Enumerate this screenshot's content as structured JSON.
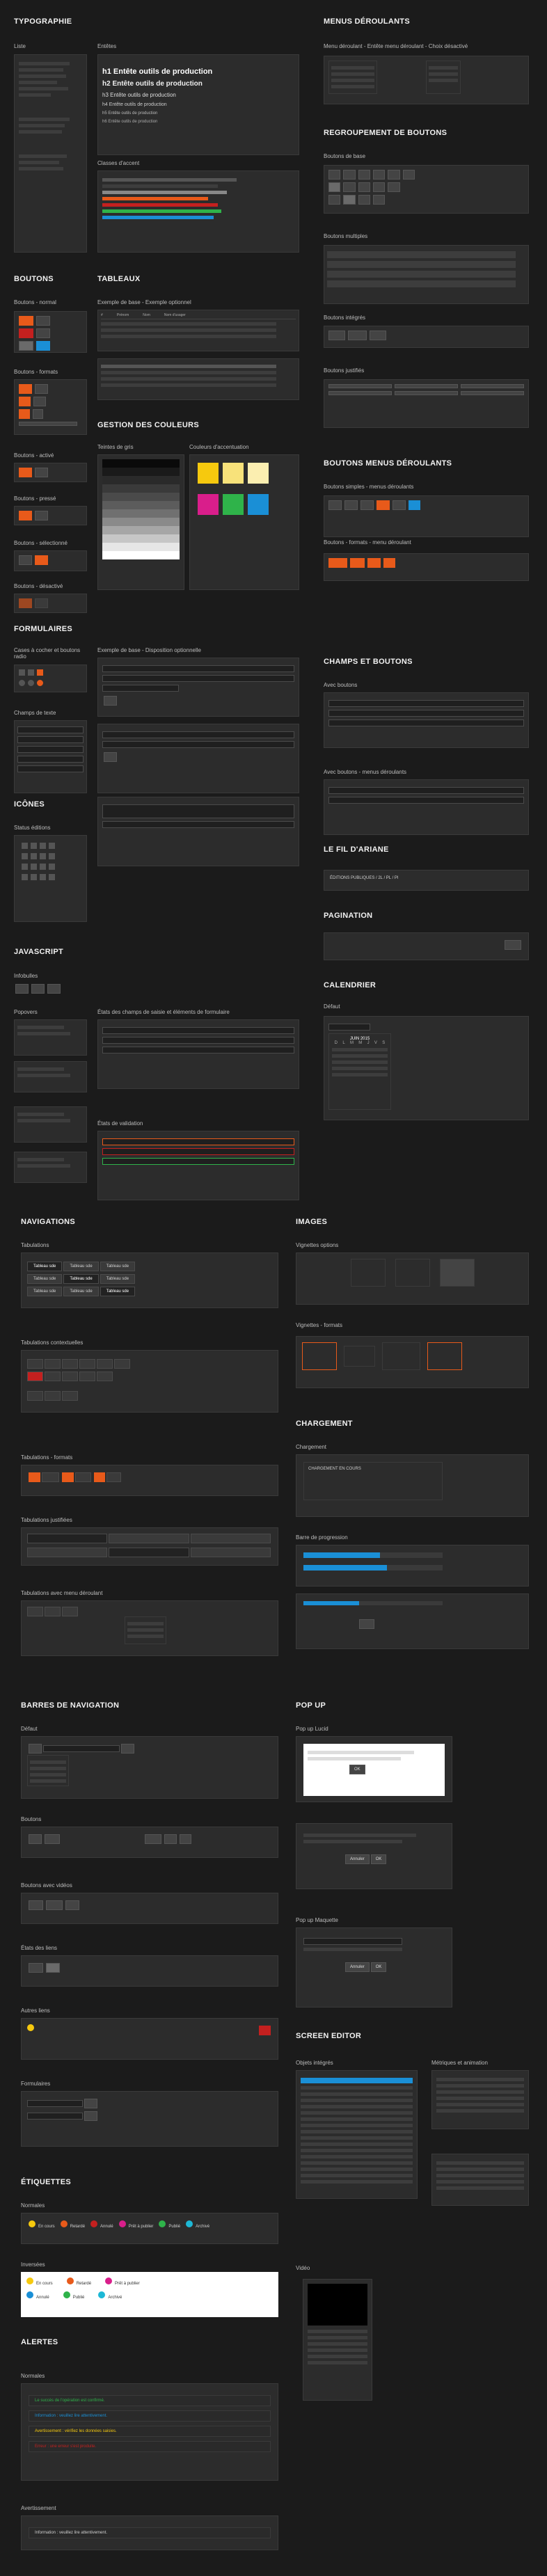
{
  "colors": {
    "accent": "#e85a1a",
    "blue": "#1a8fd6",
    "red": "#c4201f",
    "yellow": "#f6c90e",
    "green": "#2fb34a",
    "magenta": "#d91e8b",
    "cyan": "#1db8d6",
    "lime": "#86d63a"
  },
  "typo": {
    "title": "Typographie",
    "lists_label": "Liste",
    "headings_label": "Entêtes",
    "h1": "h1 Entête outils de production",
    "h2": "h2 Entête outils de production",
    "h3": "h3 Entête outils de production",
    "h4": "h4 Entête outils de production",
    "h5": "h5 Entête outils de production",
    "h6": "h6 Entête outils de production",
    "accent_label": "Classes d'accent"
  },
  "menus": {
    "title": "Menus déroulants",
    "sub": "Menu déroulant - Entête menu déroulant - Choix désactivé"
  },
  "btn_groups": {
    "title": "Regroupement de boutons",
    "basic": "Boutons de base",
    "multiple": "Boutons multiples",
    "injected": "Boutons intégrés",
    "justified": "Boutons justifiés"
  },
  "buttons": {
    "title": "Boutons",
    "normal": "Boutons - normal",
    "formats": "Boutons - formats",
    "active": "Boutons - activé",
    "pressed": "Boutons - pressé",
    "selected": "Boutons - sélectionné",
    "disabled": "Boutons - désactivé",
    "default": "Défaut"
  },
  "tables": {
    "title": "Tableaux",
    "sub": "Exemple de base - Exemple optionnel",
    "cols": [
      "#",
      "Prénom",
      "Nom",
      "Nom d'usager"
    ]
  },
  "colors_sec": {
    "title": "Gestion des couleurs",
    "grays": "Teintes de gris",
    "accent": "Couleurs d'accentuation"
  },
  "btn_menus": {
    "title": "Boutons menus déroulants",
    "simple": "Boutons simples - menus déroulants",
    "formats": "Boutons - formats - menu déroulant"
  },
  "forms": {
    "title": "Formulaires",
    "checks": "Cases à cocher et boutons radio",
    "fields": "Champs de texte",
    "basic": "Exemple de base - Disposition optionnelle",
    "states": "États des champs de saisie et éléments de formulaire",
    "validation": "États de validation"
  },
  "fields_btns": {
    "title": "Champs et boutons",
    "with": "Avec boutons",
    "with_menu": "Avec boutons - menus déroulants"
  },
  "breadcrumb": {
    "title": "Le fil d'Ariane",
    "path": "ÉDITIONS PUBLIQUES / 2L / PL / PI"
  },
  "icons": {
    "title": "Icônes",
    "status": "Status éditions"
  },
  "pagination": {
    "title": "Pagination"
  },
  "js": {
    "title": "Javascript",
    "tooltips": "Infobulles",
    "popovers": "Popovers"
  },
  "calendar": {
    "title": "Calendrier",
    "default": "Défaut",
    "month": "JUIN 2015",
    "days": [
      "D",
      "L",
      "M",
      "M",
      "J",
      "V",
      "S"
    ]
  },
  "navigations": {
    "title": "Navigations",
    "tabs": "Tabulations",
    "contextual": "Tabulations contextuelles",
    "formats": "Tabulations - formats",
    "justified": "Tabulations justifiées",
    "dropdown": "Tabulations avec menu déroulant",
    "tab_label": "Tableau sde"
  },
  "images": {
    "title": "Images",
    "options": "Vignettes options",
    "formats": "Vignettes - formats"
  },
  "loading": {
    "title": "Chargement",
    "loading": "Chargement",
    "progress": "Barre de progression",
    "text": "CHARGEMENT EN COURS",
    "progress_pct": 0.55
  },
  "navbars": {
    "title": "Barres de navigation",
    "default": "Défaut",
    "buttons": "Boutons",
    "with_videos": "Boutons avec vidéos",
    "link_states": "États des liens",
    "other": "Autres liens",
    "forms": "Formulaires"
  },
  "popup": {
    "title": "Pop up",
    "useful": "Pop up Lucid",
    "model": "Pop up Maquette",
    "ok": "OK",
    "cancel": "Annuler"
  },
  "labels": {
    "title": "Étiquettes",
    "normal": "Normales",
    "inverse": "Inversées",
    "items": [
      "En cours",
      "Retardé",
      "Annulé",
      "Prêt à publier",
      "Publié",
      "Archivé"
    ]
  },
  "screen_editor": {
    "title": "Screen editor",
    "objects": "Objets intégrés",
    "metrics": "Métriques et animation",
    "video": "Vidéo"
  },
  "alerts": {
    "title": "Alertes",
    "normal": "Normales",
    "warning": "Avertissement",
    "items": [
      "Le succès de l'opération est confirmé.",
      "Information : veuillez lire attentivement.",
      "Avertissement : vérifiez les données saisies.",
      "Erreur : une erreur s'est produite."
    ]
  }
}
